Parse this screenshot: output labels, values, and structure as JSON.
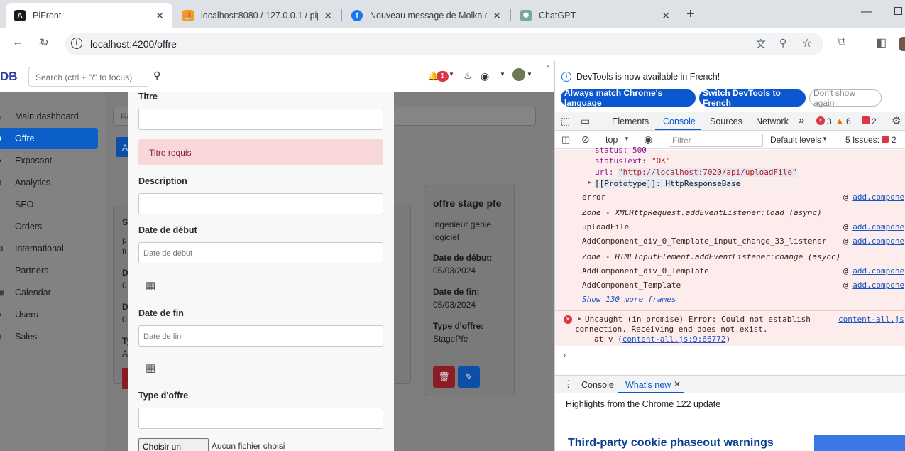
{
  "browser": {
    "tabs": [
      {
        "title": "PiFront",
        "favicon": "angular-icon",
        "active": true
      },
      {
        "title": "localhost:8080 / 127.0.0.1 / pipe",
        "favicon": "phpmyadmin-icon",
        "active": false
      },
      {
        "title": "Nouveau message de Molka da",
        "favicon": "facebook-icon",
        "active": false
      },
      {
        "title": "ChatGPT",
        "favicon": "chatgpt-icon",
        "active": false
      }
    ],
    "url": "localhost:4200/offre"
  },
  "app": {
    "brand": "DB",
    "search_placeholder": "Search (ctrl + \"/\" to focus)",
    "notification_count": "1",
    "sidebar": [
      {
        "label": "Main dashboard",
        "icon": "home-icon"
      },
      {
        "label": "Offre",
        "icon": "briefcase-icon",
        "active": true
      },
      {
        "label": "Exposant",
        "icon": "user-icon"
      },
      {
        "label": "Analytics",
        "icon": "chart-icon"
      },
      {
        "label": "SEO",
        "icon": "search-icon"
      },
      {
        "label": "Orders",
        "icon": "cart-icon"
      },
      {
        "label": "International",
        "icon": "globe-icon"
      },
      {
        "label": "Partners",
        "icon": "handshake-icon"
      },
      {
        "label": "Calendar",
        "icon": "calendar-icon"
      },
      {
        "label": "Users",
        "icon": "users-icon"
      },
      {
        "label": "Sales",
        "icon": "chart-icon"
      }
    ],
    "bg_search_placeholder": "Re",
    "bg_add_button": "A",
    "card_partial": {
      "title": "S",
      "line1": "p",
      "line2": "fu",
      "l1": "D",
      "v1": "0",
      "l2": "D",
      "v2": "0",
      "l3": "Ty",
      "v3": "A"
    },
    "card": {
      "title": "offre stage pfe",
      "description": "ingenieur genie logiciel",
      "start_label": "Date de début:",
      "start_value": "05/03/2024",
      "end_label": "Date de fin:",
      "end_value": "05/03/2024",
      "type_label": "Type d'offre:",
      "type_value": "StagePfe"
    },
    "modal": {
      "titre_label": "Titre",
      "titre_value": "",
      "titre_error": "Titre requis",
      "description_label": "Description",
      "start_label": "Date de début",
      "start_placeholder": "Date de début",
      "end_label": "Date de fin",
      "end_placeholder": "Date de fin",
      "type_label": "Type d'offre",
      "file_button": "Choisir un fichier",
      "file_status": "Aucun fichier choisi"
    }
  },
  "devtools": {
    "banner": "DevTools is now available in French!",
    "btn_match": "Always match Chrome's language",
    "btn_switch": "Switch DevTools to French",
    "btn_dismiss": "Don't show again",
    "tabs": [
      "Elements",
      "Console",
      "Sources",
      "Network"
    ],
    "errors": "3",
    "warnings": "6",
    "issues_badge": "2",
    "context": "top",
    "filter_placeholder": "Filter",
    "levels": "Default levels",
    "issues_label": "5 Issues:",
    "issues_count": "2",
    "log": {
      "status": "status: 500",
      "statusText_key": "statusText:",
      "statusText_val": "\"OK\"",
      "url_key": "url:",
      "url_val": "\"http://localhost:7020/api/uploadFile\"",
      "proto": "[[Prototype]]: HttpResponseBase",
      "frames": [
        {
          "fn": "error",
          "src": "add.compone",
          "async": false
        },
        {
          "fn": "Zone - XMLHttpRequest.addEventListener:load (async)",
          "src": "",
          "async": true
        },
        {
          "fn": "uploadFile",
          "src": "add.compone",
          "async": false
        },
        {
          "fn": "AddComponent_div_0_Template_input_change_33_listener",
          "src": "add.compone",
          "async": false
        },
        {
          "fn": "Zone - HTMLInputElement.addEventListener:change (async)",
          "src": "",
          "async": true
        },
        {
          "fn": "AddComponent_div_0_Template",
          "src": "add.compone",
          "async": false
        },
        {
          "fn": "AddComponent_Template",
          "src": "add.compone",
          "async": false
        }
      ],
      "show_more": "Show 130 more frames",
      "uncaught_line1": "Uncaught (in promise) Error: Could not establish",
      "uncaught_line2": "connection. Receiving end does not exist.",
      "uncaught_at": "at v (",
      "uncaught_link": "content-all.js:9:66772",
      "uncaught_close": ")",
      "uncaught_src": "content-all.js"
    },
    "drawer_tabs": [
      "Console",
      "What's new"
    ],
    "highlights": "Highlights from the Chrome 122 update",
    "news_title": "Third-party cookie phaseout warnings"
  }
}
